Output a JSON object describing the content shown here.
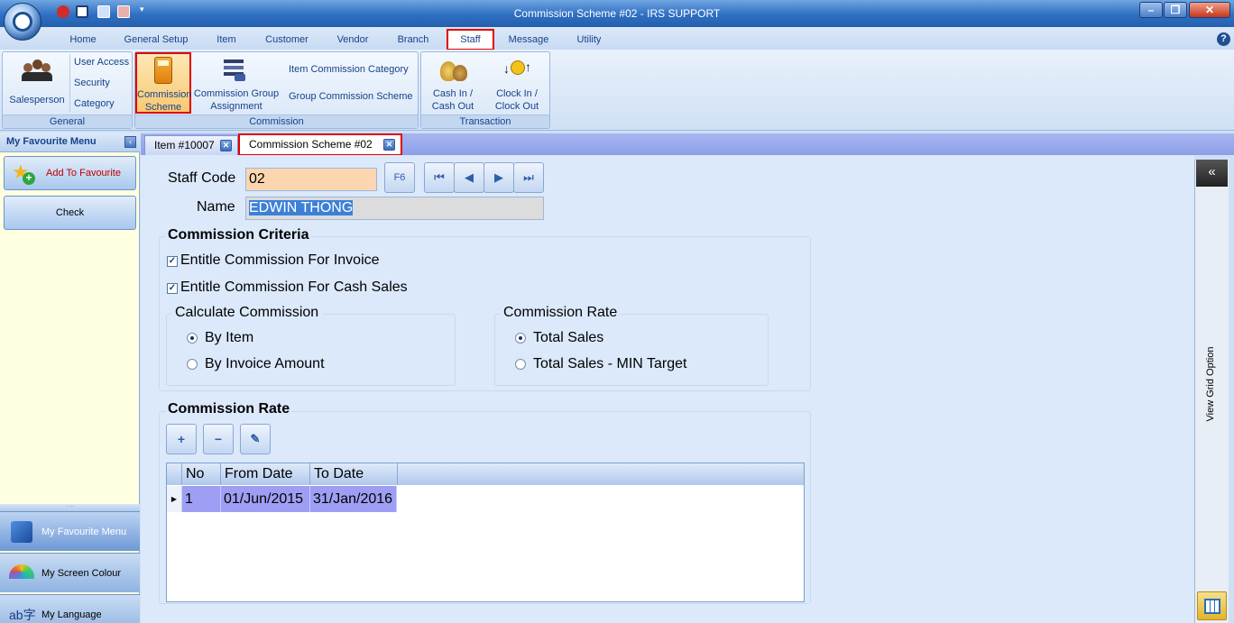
{
  "window": {
    "title": "Commission Scheme #02 - IRS SUPPORT"
  },
  "ribbon_tabs": [
    {
      "label": "Home"
    },
    {
      "label": "General Setup"
    },
    {
      "label": "Item"
    },
    {
      "label": "Customer"
    },
    {
      "label": "Vendor"
    },
    {
      "label": "Branch"
    },
    {
      "label": "Staff",
      "active": true
    },
    {
      "label": "Message"
    },
    {
      "label": "Utility"
    }
  ],
  "ribbon": {
    "general": {
      "label": "General",
      "salesperson": "Salesperson",
      "user_access": "User Access",
      "security": "Security",
      "category": "Category"
    },
    "commission": {
      "label": "Commission",
      "scheme_line1": "Commission",
      "scheme_line2": "Scheme",
      "group_assign_line1": "Commission Group",
      "group_assign_line2": "Assignment",
      "item_category": "Item Commission Category",
      "group_scheme": "Group Commission Scheme"
    },
    "transaction": {
      "label": "Transaction",
      "cash_line1": "Cash In /",
      "cash_line2": "Cash Out",
      "clock_line1": "Clock In /",
      "clock_line2": "Clock Out"
    }
  },
  "left_pane": {
    "title": "My Favourite Menu",
    "add_favourite": "Add To Favourite",
    "check": "Check",
    "nav": [
      "My Favourite Menu",
      "My Screen Colour",
      "My Language"
    ]
  },
  "doc_tabs": [
    {
      "label": "Item #10007"
    },
    {
      "label": "Commission Scheme #02",
      "active": true
    }
  ],
  "form": {
    "staff_code_label": "Staff Code",
    "staff_code": "02",
    "f6": "F6",
    "name_label": "Name",
    "name": "EDWIN THONG",
    "criteria_title": "Commission Criteria",
    "entitle_invoice": "Entitle Commission For Invoice",
    "entitle_invoice_checked": true,
    "entitle_cash": "Entitle Commission For Cash Sales",
    "entitle_cash_checked": true,
    "calc_title": "Calculate Commission",
    "calc_by_item": "By Item",
    "calc_by_invoice": "By Invoice Amount",
    "calc_selected": "By Item",
    "rate_title": "Commission Rate",
    "rate_total": "Total Sales",
    "rate_total_min": "Total Sales - MIN Target",
    "rate_selected": "Total Sales",
    "rate_section_title": "Commission Rate"
  },
  "grid": {
    "columns": [
      "No",
      "From Date",
      "To Date"
    ],
    "rows": [
      [
        "1",
        "01/Jun/2015",
        "31/Jan/2016"
      ]
    ]
  },
  "right_bar": {
    "label": "View Grid Option"
  },
  "colors": {
    "active_tab_border": "#e00000",
    "grid_row": "#9e9ef4",
    "staff_code_bg": "#fbd6b0"
  }
}
